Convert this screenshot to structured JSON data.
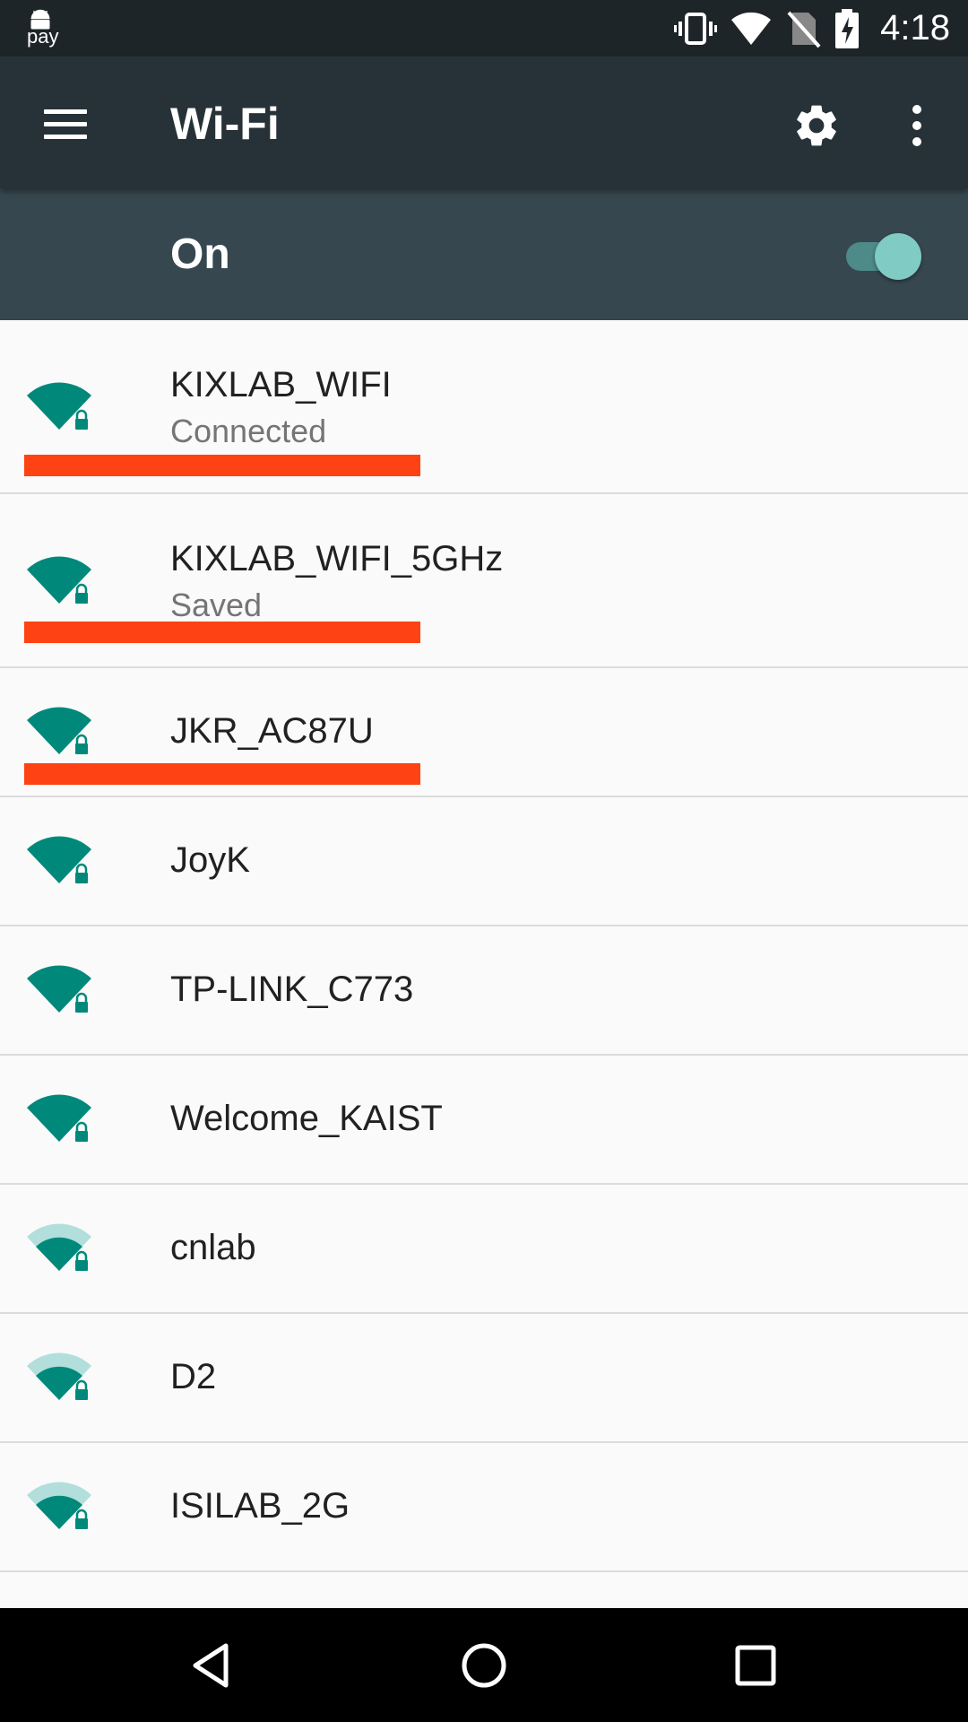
{
  "status_bar": {
    "pay_label": "pay",
    "time": "4:18",
    "icons": [
      "android-icon",
      "vibrate-icon",
      "wifi-signal-icon",
      "no-sim-icon",
      "battery-charging-icon"
    ]
  },
  "toolbar": {
    "title": "Wi-Fi",
    "icons": [
      "menu-icon",
      "gear-icon",
      "more-vert-icon"
    ]
  },
  "wifi_switch": {
    "label": "On",
    "state": "on"
  },
  "networks": [
    {
      "ssid": "KIXLAB_WIFI",
      "status": "Connected",
      "signal": "strong",
      "secured": true,
      "highlighted": true
    },
    {
      "ssid": "KIXLAB_WIFI_5GHz",
      "status": "Saved",
      "signal": "strong",
      "secured": true,
      "highlighted": true
    },
    {
      "ssid": "JKR_AC87U",
      "status": "",
      "signal": "strong",
      "secured": true,
      "highlighted": true
    },
    {
      "ssid": "JoyK",
      "status": "",
      "signal": "strong",
      "secured": true,
      "highlighted": false
    },
    {
      "ssid": "TP-LINK_C773",
      "status": "",
      "signal": "strong",
      "secured": true,
      "highlighted": false
    },
    {
      "ssid": "Welcome_KAIST",
      "status": "",
      "signal": "strong",
      "secured": true,
      "highlighted": false
    },
    {
      "ssid": "cnlab",
      "status": "",
      "signal": "medium",
      "secured": true,
      "highlighted": false
    },
    {
      "ssid": "D2",
      "status": "",
      "signal": "medium",
      "secured": true,
      "highlighted": false
    },
    {
      "ssid": "ISILAB_2G",
      "status": "",
      "signal": "medium",
      "secured": true,
      "highlighted": false
    }
  ],
  "colors": {
    "accent": "#00897b",
    "accent_light": "#b2dfdb",
    "highlight": "#ff4213",
    "toolbar": "#263238",
    "switch_bar": "#37474f"
  },
  "nav_bar": {
    "icons": [
      "back-icon",
      "home-icon",
      "recents-icon"
    ]
  }
}
